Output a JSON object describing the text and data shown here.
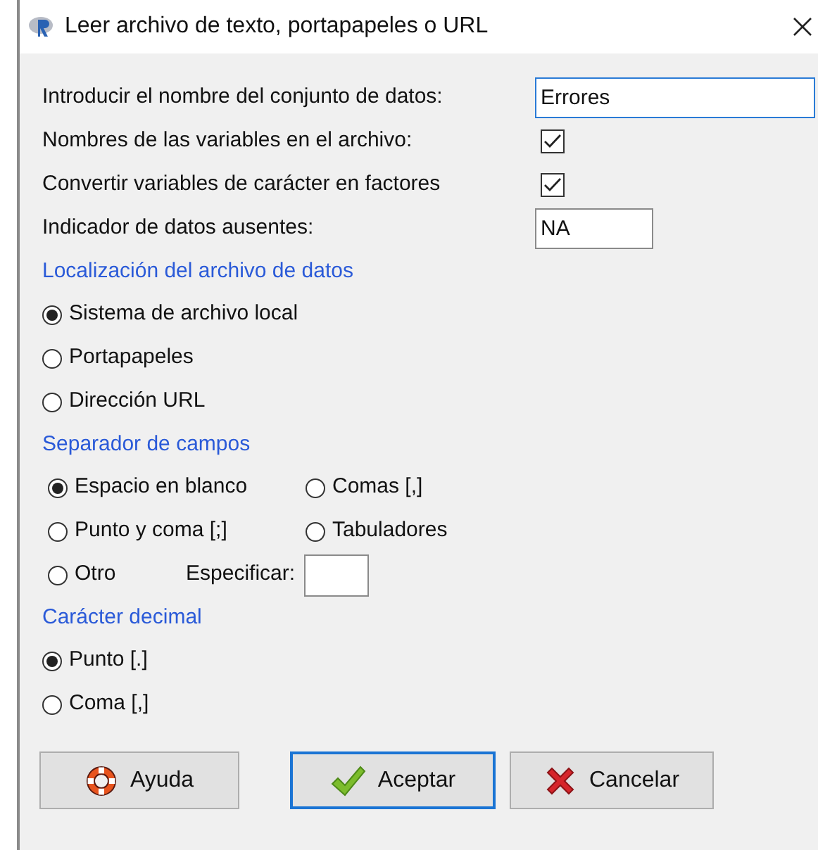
{
  "window": {
    "title": "Leer archivo de texto, portapapeles o URL"
  },
  "fields": [
    {
      "kind": "text",
      "label": "Introducir el nombre del conjunto de datos:",
      "value": "Errores",
      "focused": true
    },
    {
      "kind": "checkbox",
      "label": "Nombres de las variables en el archivo:",
      "checked": true
    },
    {
      "kind": "checkbox",
      "label": "Convertir variables de carácter en factores",
      "checked": true
    },
    {
      "kind": "text",
      "label": "Indicador de datos ausentes:",
      "value": "NA",
      "focused": false
    }
  ],
  "sections": [
    {
      "heading": "Localización del archivo de datos",
      "kind": "list",
      "options": [
        {
          "label": "Sistema de archivo local",
          "selected": true
        },
        {
          "label": "Portapapeles",
          "selected": false
        },
        {
          "label": "Dirección URL",
          "selected": false
        }
      ]
    },
    {
      "heading": "Separador de campos",
      "kind": "grid",
      "options": [
        {
          "label": "Espacio en blanco",
          "selected": true
        },
        {
          "label": "Comas [,]",
          "selected": false
        },
        {
          "label": "Punto y coma [;]",
          "selected": false
        },
        {
          "label": "Tabuladores",
          "selected": false
        },
        {
          "label": "Otro",
          "selected": false
        }
      ],
      "specify": {
        "label": "Especificar:"
      }
    },
    {
      "heading": "Carácter decimal",
      "kind": "list",
      "options": [
        {
          "label": "Punto [.]",
          "selected": true
        },
        {
          "label": "Coma [,]",
          "selected": false
        }
      ]
    }
  ],
  "buttons": [
    {
      "kind": "help",
      "label": "Ayuda",
      "focused": false
    },
    {
      "kind": "ok",
      "label": "Aceptar",
      "focused": true
    },
    {
      "kind": "cancel",
      "label": "Cancelar",
      "focused": false
    }
  ]
}
